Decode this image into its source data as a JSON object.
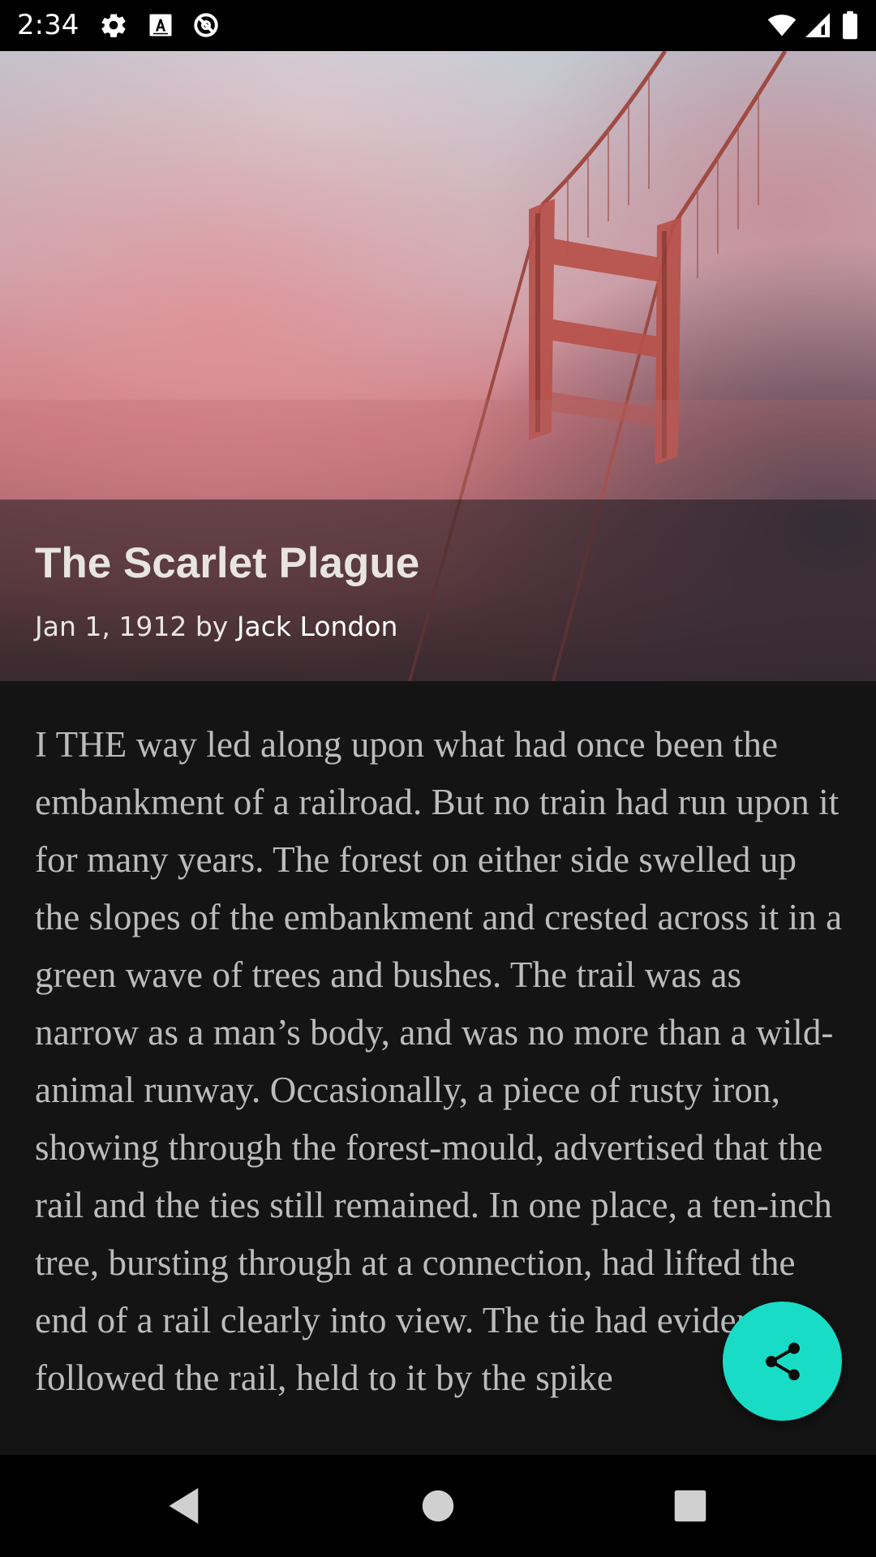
{
  "status_bar": {
    "time": "2:34",
    "left_icons": [
      "gear-icon",
      "text-a-icon",
      "data-saver-icon"
    ],
    "right_icons": [
      "wifi-icon",
      "cell-signal-icon",
      "battery-icon"
    ]
  },
  "article": {
    "title": "The Scarlet Plague",
    "date": "Jan 1, 1912",
    "by_word": "by",
    "author": "Jack London",
    "body": "I THE way led along upon what had once been the embankment of a railroad. But no train had run upon it for many years. The forest on either side swelled up the slopes of the embankment and crested across it in a green wave of trees and bushes. The trail was as narrow as a man’s body, and was no more than a wild-animal runway. Occasionally, a piece of rusty iron, showing through the forest-mould, advertised that the rail and the ties still remained. In one place, a ten-inch tree, bursting through at a connection, had lifted the end of a rail clearly into view. The tie had evidently followed the rail, held to it by the spike"
  },
  "fab": {
    "icon": "share-icon",
    "color": "#18dcc6"
  },
  "nav_bar": {
    "icons": [
      "back-icon",
      "home-icon",
      "recents-icon"
    ]
  },
  "colors": {
    "background": "#141414",
    "body_text": "#bcbcbc",
    "title_text": "#e8e4e2"
  }
}
